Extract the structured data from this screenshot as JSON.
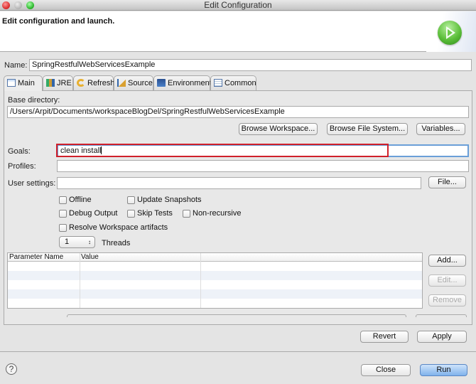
{
  "window": {
    "title": "Edit Configuration"
  },
  "header": {
    "title": "Edit configuration and launch.",
    "icon": "run-play-icon"
  },
  "name": {
    "label": "Name:",
    "value": "SpringRestfulWebServicesExample"
  },
  "tabs": [
    {
      "label": "Main",
      "icon": "main-tab-icon",
      "active": true
    },
    {
      "label": "JRE",
      "icon": "jre-icon",
      "active": false
    },
    {
      "label": "Refresh",
      "icon": "refresh-icon",
      "active": false
    },
    {
      "label": "Source",
      "icon": "source-icon",
      "active": false
    },
    {
      "label": "Environment",
      "icon": "environment-icon",
      "active": false
    },
    {
      "label": "Common",
      "icon": "common-icon",
      "active": false
    }
  ],
  "main": {
    "base_directory": {
      "label": "Base directory:",
      "value": "/Users/Arpit/Documents/workspaceBlogDel/SpringRestfulWebServicesExample"
    },
    "browse_workspace": "Browse Workspace...",
    "browse_file_system": "Browse File System...",
    "variables": "Variables...",
    "goals": {
      "label": "Goals:",
      "value": "clean install"
    },
    "profiles": {
      "label": "Profiles:",
      "value": ""
    },
    "user_settings": {
      "label": "User settings:",
      "value": ""
    },
    "file_button": "File...",
    "checkboxes": [
      {
        "label": "Offline",
        "checked": false
      },
      {
        "label": "Update Snapshots",
        "checked": false
      },
      {
        "label": "Debug Output",
        "checked": false
      },
      {
        "label": "Skip Tests",
        "checked": false
      },
      {
        "label": "Non-recursive",
        "checked": false
      },
      {
        "label": "Resolve Workspace artifacts",
        "checked": false
      }
    ],
    "threads": {
      "value": "1",
      "label": "Threads"
    },
    "params_table": {
      "columns": [
        "Parameter Name",
        "Value",
        ""
      ],
      "rows": []
    },
    "add_button": "Add...",
    "edit_button": "Edit...",
    "remove_button": "Remove"
  },
  "footer": {
    "revert": "Revert",
    "apply": "Apply",
    "close": "Close",
    "run": "Run",
    "help_icon": "?"
  },
  "colors": {
    "highlight": "#d0202a",
    "focus": "#6a9fd8",
    "run_button": "#7fb2ec"
  }
}
